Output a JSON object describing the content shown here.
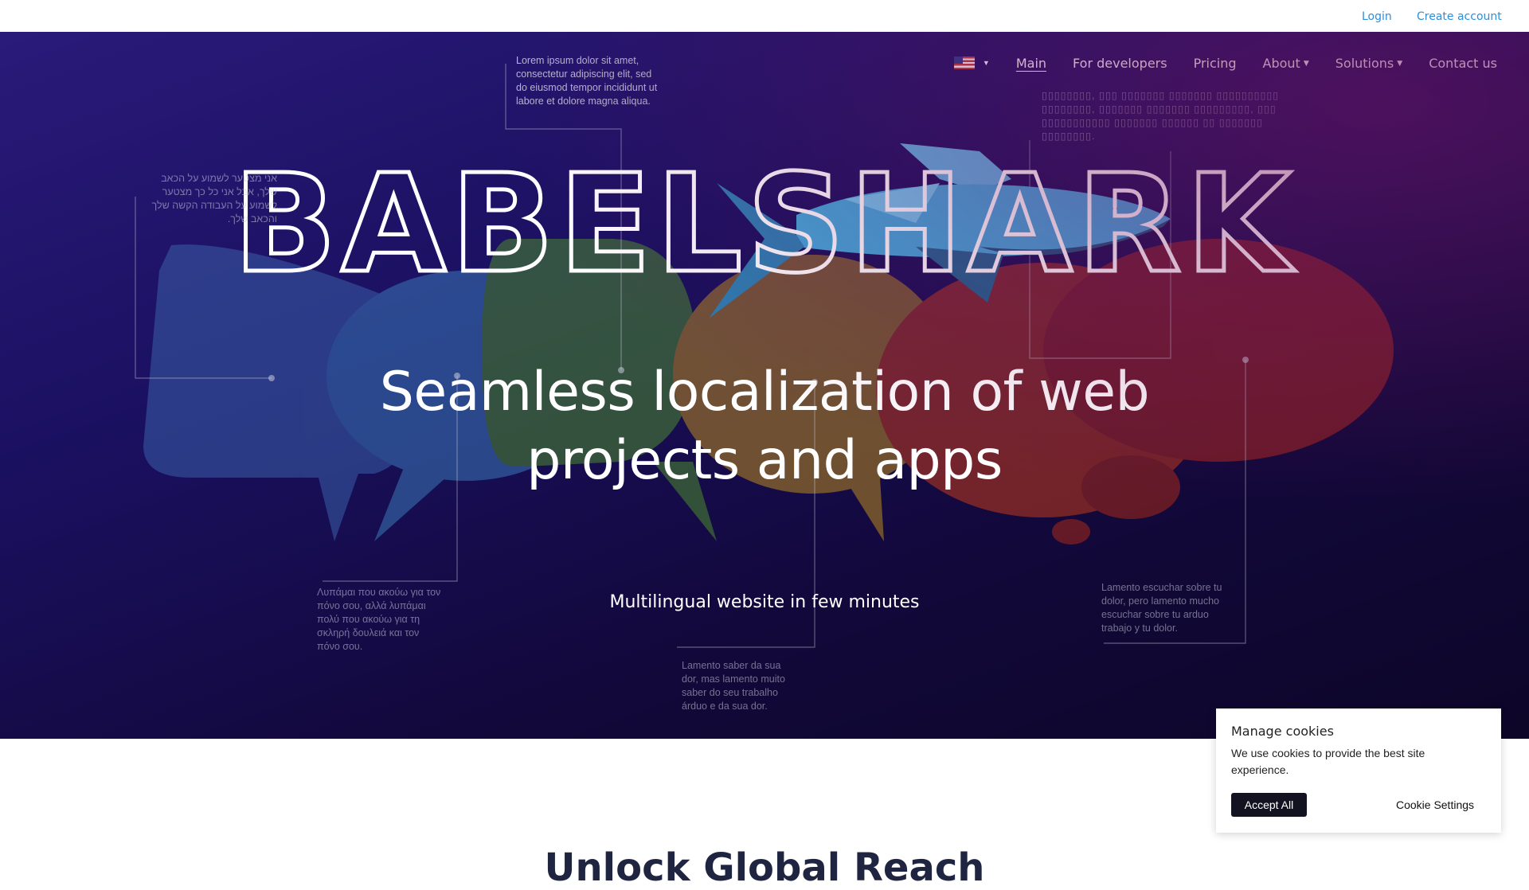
{
  "topbar": {
    "login": "Login",
    "create_account": "Create account"
  },
  "nav": {
    "language_icon": "us-flag-icon",
    "items": [
      {
        "label": "Main",
        "active": true
      },
      {
        "label": "For developers"
      },
      {
        "label": "Pricing"
      },
      {
        "label": "About",
        "has_dropdown": true
      },
      {
        "label": "Solutions",
        "has_dropdown": true
      },
      {
        "label": "Contact us"
      }
    ]
  },
  "hero": {
    "logo": "BABELSHARK",
    "headline_line1": "Seamless localization of web",
    "headline_line2": "projects and apps",
    "subheadline": "Multilingual website in few minutes",
    "notes": {
      "latin": "Lorem ipsum dolor sit amet, consectetur adipiscing elit, sed do eiusmod tempor incididunt ut labore et dolore magna aliqua.",
      "hebrew": "אני מצטער לשמוע על הכאב שלך, אבל אני כל כך מצטער לשמוע על העבודה הקשה שלך והכאב שלך.",
      "greek": "Λυπάμαι που ακούω για τον πόνο σου, αλλά λυπάμαι πολύ που ακούω για τη σκληρή δουλειά και τον πόνο σου.",
      "portuguese": "Lamento saber da sua dor, mas lamento muito saber do seu trabalho árduo e da sua dor.",
      "spanish": "Lamento escuchar sobre tu dolor, pero lamento mucho escuchar sobre tu arduo trabajo y tu dolor.",
      "placeholder_glyphs": "▯▯▯▯▯▯▯▯, ▯▯▯ ▯▯▯▯▯▯▯ ▯▯▯▯▯▯▯ ▯▯▯▯▯▯▯▯▯▯ ▯▯▯▯▯▯▯▯, ▯▯▯▯▯▯▯ ▯▯▯▯▯▯▯ ▯▯▯▯▯▯▯▯▯, ▯▯▯ ▯▯▯▯▯▯▯▯▯▯▯ ▯▯▯▯▯▯▯ ▯▯▯▯▯▯ ▯▯ ▯▯▯▯▯▯▯ ▯▯▯▯▯▯▯▯."
    },
    "colors": {
      "blue_bubble": "#3a6fb0",
      "green_bubble": "#4c8a2e",
      "orange_bubble": "#b8771b",
      "red_bubble": "#b8321c",
      "shark": "#3fa6d8"
    }
  },
  "section": {
    "title": "Unlock Global Reach"
  },
  "cookie": {
    "title": "Manage cookies",
    "text": "We use cookies to provide the best site experience.",
    "accept": "Accept All",
    "settings": "Cookie Settings"
  }
}
